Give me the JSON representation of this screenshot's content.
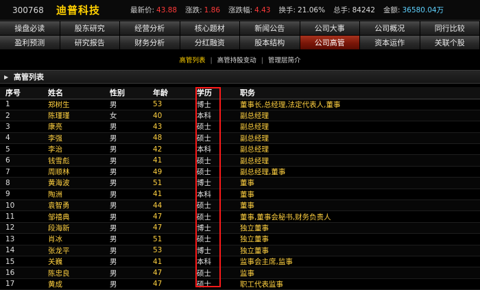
{
  "quote": {
    "code": "300768",
    "name": "迪普科技",
    "items": [
      {
        "label": "最新价:",
        "value": "43.88",
        "color": "red"
      },
      {
        "label": "涨跌:",
        "value": "1.86",
        "color": "red"
      },
      {
        "label": "涨跌幅:",
        "value": "4.43",
        "color": "red"
      },
      {
        "label": "换手:",
        "value": "21.06%",
        "color": "white"
      },
      {
        "label": "总手:",
        "value": "84242",
        "color": "white"
      },
      {
        "label": "金额:",
        "value": "36580.04万",
        "color": "cyan"
      }
    ]
  },
  "nav": {
    "row1": [
      "操盘必读",
      "股东研究",
      "经营分析",
      "核心题材",
      "新闻公告",
      "公司大事",
      "公司概况",
      "同行比较"
    ],
    "row2": [
      "盈利预测",
      "研究报告",
      "财务分析",
      "分红融资",
      "股本结构",
      "公司高管",
      "资本运作",
      "关联个股"
    ],
    "active": "公司高管"
  },
  "subnav": {
    "items": [
      "高管列表",
      "高管持股变动",
      "管理层简介"
    ],
    "active": "高管列表"
  },
  "section": {
    "title": "高管列表"
  },
  "table": {
    "headers": [
      "序号",
      "姓名",
      "性别",
      "年龄",
      "学历",
      "职务"
    ],
    "rows": [
      [
        "1",
        "郑树生",
        "男",
        "53",
        "博士",
        "董事长,总经理,法定代表人,董事"
      ],
      [
        "2",
        "陈瑾瑾",
        "女",
        "40",
        "本科",
        "副总经理"
      ],
      [
        "3",
        "康亮",
        "男",
        "43",
        "硕士",
        "副总经理"
      ],
      [
        "4",
        "李强",
        "男",
        "48",
        "硕士",
        "副总经理"
      ],
      [
        "5",
        "李治",
        "男",
        "42",
        "本科",
        "副总经理"
      ],
      [
        "6",
        "钱雪彪",
        "男",
        "41",
        "硕士",
        "副总经理"
      ],
      [
        "7",
        "周顺林",
        "男",
        "49",
        "硕士",
        "副总经理,董事"
      ],
      [
        "8",
        "黄海波",
        "男",
        "51",
        "博士",
        "董事"
      ],
      [
        "9",
        "陶洲",
        "男",
        "41",
        "本科",
        "董事"
      ],
      [
        "10",
        "袁智勇",
        "男",
        "44",
        "硕士",
        "董事"
      ],
      [
        "11",
        "邹禧典",
        "男",
        "47",
        "硕士",
        "董事,董事会秘书,财务负责人"
      ],
      [
        "12",
        "段海新",
        "男",
        "47",
        "博士",
        "独立董事"
      ],
      [
        "13",
        "肖冰",
        "男",
        "51",
        "硕士",
        "独立董事"
      ],
      [
        "14",
        "张龙平",
        "男",
        "53",
        "博士",
        "独立董事"
      ],
      [
        "15",
        "关巍",
        "男",
        "41",
        "本科",
        "监事会主席,监事"
      ],
      [
        "16",
        "陈忠良",
        "男",
        "47",
        "硕士",
        "监事"
      ],
      [
        "17",
        "黄成",
        "男",
        "47",
        "硕士",
        "职工代表监事"
      ]
    ]
  },
  "highlight": {
    "column": "学历",
    "color": "#ff1a1a"
  }
}
